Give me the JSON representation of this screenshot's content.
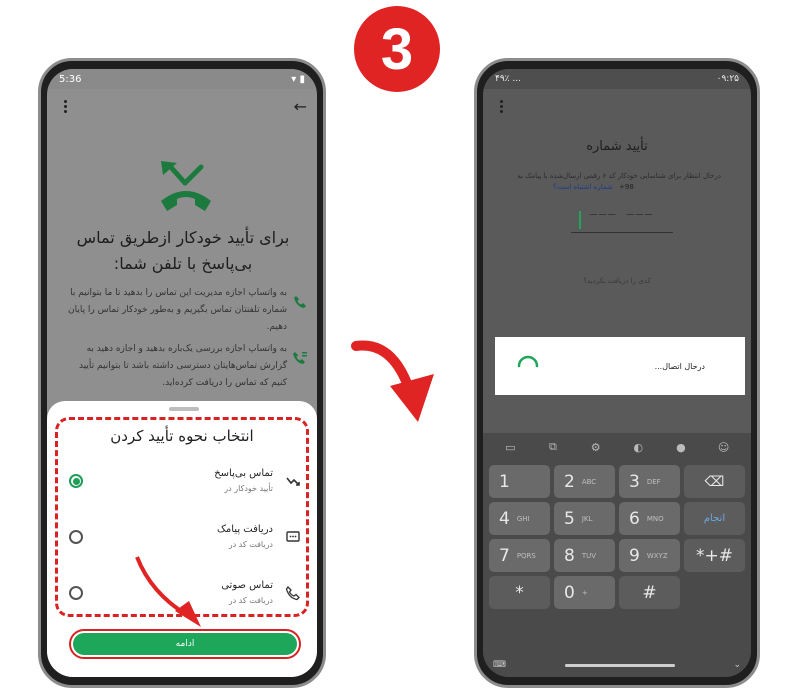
{
  "step": {
    "number": "3"
  },
  "left": {
    "status": {
      "time": "5:36"
    },
    "headline": "برای تأیید خودکار ازطریق تماس بی‌پاسخ با تلفن شما:",
    "descriptions": [
      "به واتساپ اجازه مدیریت این تماس را بدهید تا ما بتوانیم با شماره تلفنتان تماس بگیریم و به‌طور خودکار تماس را پایان دهیم.",
      "به واتساپ اجازه بررسی یک‌باره بدهید و اجازه دهید به گزارش تماس‌هایتان دسترسی داشته باشد تا بتوانیم تأیید کنیم که تماس را دریافت کرده‌اید."
    ],
    "sheet": {
      "title": "انتخاب نحوه تأیید کردن",
      "options": [
        {
          "title": "تماس بی‌پاسخ",
          "subtitle": "تأیید خودکار در",
          "icon": "missed-call-icon",
          "selected": true
        },
        {
          "title": "دریافت پیامک",
          "subtitle": "دریافت کد در",
          "icon": "sms-icon",
          "selected": false
        },
        {
          "title": "تماس صوتی",
          "subtitle": "دریافت کد در",
          "icon": "phone-icon",
          "selected": false
        }
      ],
      "continue_label": "ادامه"
    }
  },
  "right": {
    "status": {
      "time": "۰۹:۲۵",
      "left_info": "۴۹٪ ..."
    },
    "title": "تأیید شماره",
    "description": "درحال انتظار برای شناسایی خودکار کد ۶ رقمی ارسال‌شده با پیامک به",
    "phone_prefix": "+98",
    "wrong_number_link": "شماره اشتباه است؟",
    "code_placeholder": "––– –––",
    "resend_text": "کدی را دریافت نکردید؟",
    "dialog_text": "درحال اتصال...",
    "keyboard": {
      "keys": [
        {
          "num": "1",
          "letters": ""
        },
        {
          "num": "2",
          "letters": "ABC"
        },
        {
          "num": "3",
          "letters": "DEF"
        },
        {
          "num": "⌫",
          "letters": "",
          "type": "fn"
        },
        {
          "num": "4",
          "letters": "GHI"
        },
        {
          "num": "5",
          "letters": "JKL"
        },
        {
          "num": "6",
          "letters": "MNO"
        },
        {
          "num": "انجام",
          "letters": "",
          "type": "enter"
        },
        {
          "num": "7",
          "letters": "PQRS"
        },
        {
          "num": "8",
          "letters": "TUV"
        },
        {
          "num": "9",
          "letters": "WXYZ"
        },
        {
          "num": "*+#",
          "letters": "",
          "type": "sym"
        },
        {
          "num": "*",
          "letters": "",
          "type": "sym"
        },
        {
          "num": "0",
          "letters": "+"
        },
        {
          "num": "#",
          "letters": "",
          "type": "sym"
        },
        {
          "num": "",
          "letters": "",
          "type": "blank"
        }
      ]
    }
  },
  "colors": {
    "accent_green": "#1ea65a",
    "annotation_red": "#d92323"
  }
}
